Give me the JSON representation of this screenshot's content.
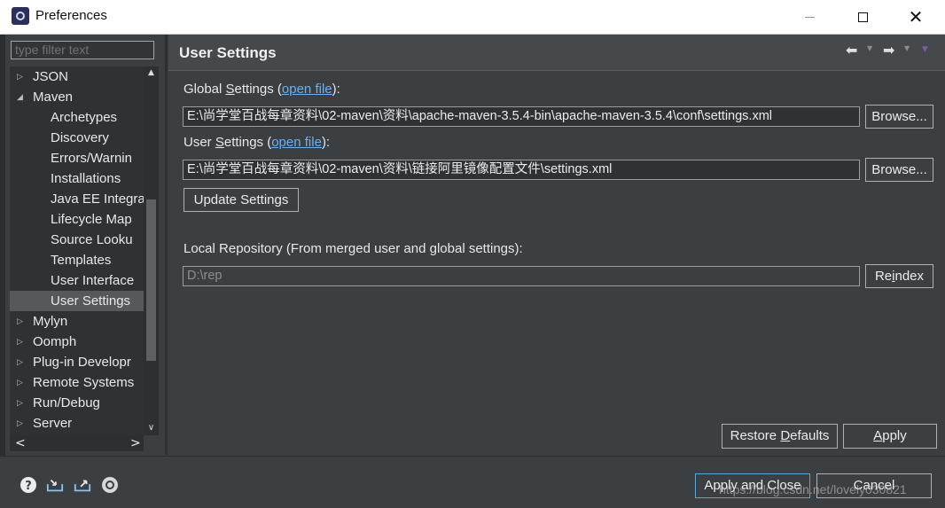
{
  "window": {
    "title": "Preferences",
    "close_glyph": "✕"
  },
  "sidebar": {
    "filter_placeholder": "type filter text",
    "items": [
      {
        "label": "JSON",
        "arrow": "▷"
      },
      {
        "label": "Maven",
        "arrow": "◢"
      },
      {
        "label": "Archetypes"
      },
      {
        "label": "Discovery"
      },
      {
        "label": "Errors/Warnin"
      },
      {
        "label": "Installations"
      },
      {
        "label": "Java EE Integra"
      },
      {
        "label": "Lifecycle Map"
      },
      {
        "label": "Source Looku"
      },
      {
        "label": "Templates"
      },
      {
        "label": "User Interface"
      },
      {
        "label": "User Settings",
        "selected": true
      },
      {
        "label": "Mylyn",
        "arrow": "▷"
      },
      {
        "label": "Oomph",
        "arrow": "▷"
      },
      {
        "label": "Plug-in Developr",
        "arrow": "▷"
      },
      {
        "label": "Remote Systems",
        "arrow": "▷"
      },
      {
        "label": "Run/Debug",
        "arrow": "▷"
      },
      {
        "label": "Server",
        "arrow": "▷"
      }
    ],
    "scroll_up": "▲",
    "scroll_down": "∨",
    "scroll_left": "<",
    "scroll_right": ">"
  },
  "page": {
    "title": "User Settings",
    "nav_back": "⬅",
    "nav_forward": "➡",
    "dropdown": "▼",
    "global_settings": {
      "label_pre": "Global ",
      "label_ul": "S",
      "label_post": "ettings (",
      "link": "open file",
      "label_end": "):",
      "value": "E:\\尚学堂百战每章资料\\02-maven\\资料\\apache-maven-3.5.4-bin\\apache-maven-3.5.4\\conf\\settings.xml",
      "browse": "Browse..."
    },
    "user_settings": {
      "label_pre": "User ",
      "label_ul": "S",
      "label_post": "ettings (",
      "link": "open file",
      "label_end": "):",
      "value": "E:\\尚学堂百战每章资料\\02-maven\\资料\\链接阿里镜像配置文件\\settings.xml",
      "browse": "Browse..."
    },
    "update_settings": "Update Settings",
    "local_repo": {
      "label": "Local Repository (From merged user and global settings):",
      "value": "D:\\rep",
      "reindex_pre": "Re",
      "reindex_ul": "i",
      "reindex_post": "ndex"
    },
    "restore_defaults_pre": "Restore ",
    "restore_defaults_ul": "D",
    "restore_defaults_post": "efaults",
    "apply_ul": "A",
    "apply_post": "pply"
  },
  "footer": {
    "apply_close": "Apply and Close",
    "cancel": "Cancel",
    "watermark": "https://blog.csdn.net/lovely030821"
  },
  "colors": {
    "background": "#3b3f42",
    "link": "#6ab0f3",
    "selected": "#55595c"
  }
}
